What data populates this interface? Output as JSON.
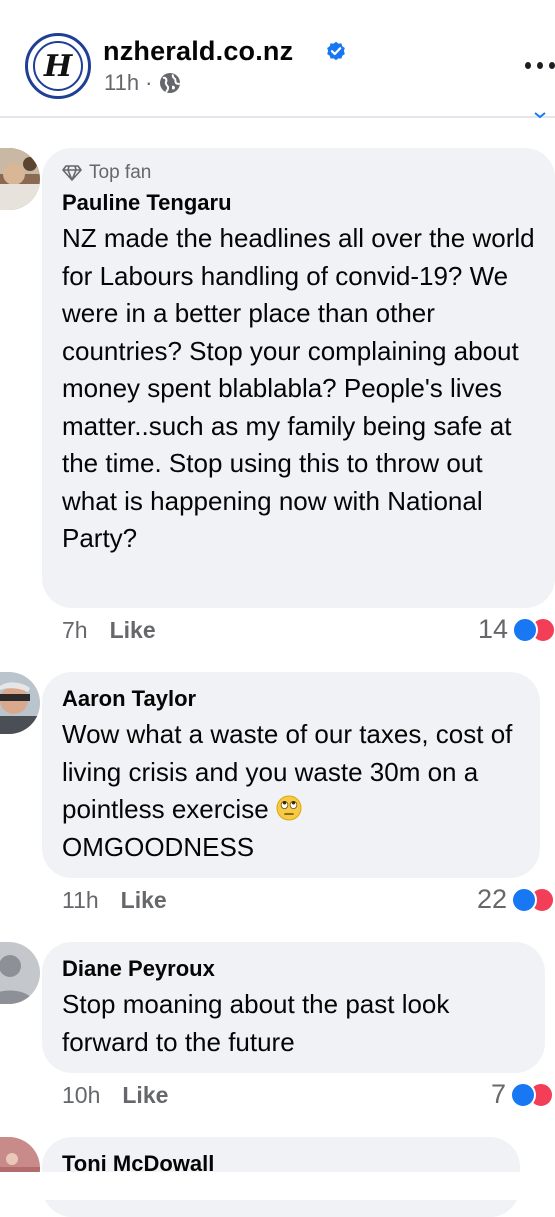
{
  "header": {
    "page_name": "nzherald.co.nz",
    "time": "11h",
    "separator": "·"
  },
  "comments": [
    {
      "badge": "Top fan",
      "author": "Pauline Tengaru",
      "text": "NZ made the headlines all over the world for Labours handling of convid-19? We were in a better place than other countries? Stop your complaining about money spent blablabla? People's lives matter..such as my family being safe at the time. Stop using this to throw out what is happening now with National Party?",
      "time": "7h",
      "like_label": "Like",
      "reaction_count": "14"
    },
    {
      "author": "Aaron Taylor",
      "text": "Wow what a waste of our taxes, cost of living crisis and you waste 30m on a pointless exercise",
      "text_tail": "OMGOODNESS",
      "time": "11h",
      "like_label": "Like",
      "reaction_count": "22"
    },
    {
      "author": "Diane Peyroux",
      "text": "Stop moaning about the past look forward to the future",
      "time": "10h",
      "like_label": "Like",
      "reaction_count": "7"
    },
    {
      "author": "Toni McDowall"
    }
  ],
  "colors": {
    "bubble": "#f0f2f5",
    "meta": "#65676b",
    "verified": "#1877f2",
    "like": "#1877f2",
    "love": "#f33e58"
  }
}
